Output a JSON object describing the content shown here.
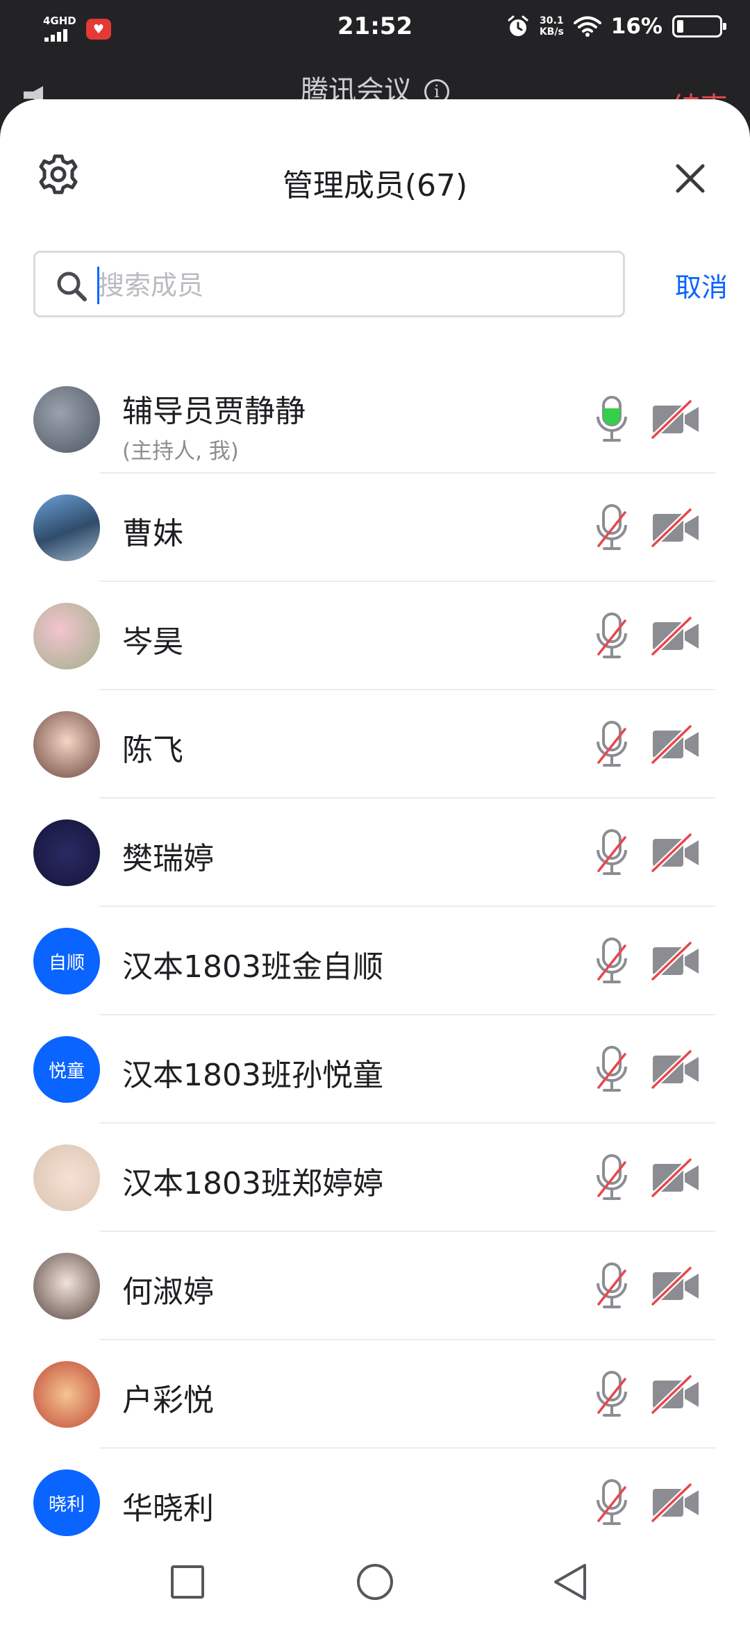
{
  "status_bar": {
    "network": "4GHD",
    "time": "21:52",
    "speed_value": "30.1",
    "speed_unit": "KB/s",
    "battery_percent": "16%",
    "battery_level": 0.16
  },
  "meeting": {
    "title": "腾讯会议",
    "end_label": "结束"
  },
  "sheet": {
    "title": "管理成员(67)",
    "search_placeholder": "搜索成员",
    "cancel_label": "取消"
  },
  "members": [
    {
      "name": "辅导员贾静静",
      "subtitle": "(主持人, 我)",
      "avatar": "photo",
      "avatar_text": "",
      "mic_on": true,
      "camera_on": false
    },
    {
      "name": "曹妹",
      "subtitle": "",
      "avatar": "photo",
      "avatar_text": "",
      "mic_on": false,
      "camera_on": false
    },
    {
      "name": "岑昊",
      "subtitle": "",
      "avatar": "photo",
      "avatar_text": "",
      "mic_on": false,
      "camera_on": false
    },
    {
      "name": "陈飞",
      "subtitle": "",
      "avatar": "photo",
      "avatar_text": "",
      "mic_on": false,
      "camera_on": false
    },
    {
      "name": "樊瑞婷",
      "subtitle": "",
      "avatar": "photo",
      "avatar_text": "",
      "mic_on": false,
      "camera_on": false
    },
    {
      "name": "汉本1803班金自顺",
      "subtitle": "",
      "avatar": "text",
      "avatar_text": "自顺",
      "mic_on": false,
      "camera_on": false
    },
    {
      "name": "汉本1803班孙悦童",
      "subtitle": "",
      "avatar": "text",
      "avatar_text": "悦童",
      "mic_on": false,
      "camera_on": false
    },
    {
      "name": "汉本1803班郑婷婷",
      "subtitle": "",
      "avatar": "photo",
      "avatar_text": "",
      "mic_on": false,
      "camera_on": false
    },
    {
      "name": "何淑婷",
      "subtitle": "",
      "avatar": "photo",
      "avatar_text": "",
      "mic_on": false,
      "camera_on": false
    },
    {
      "name": "户彩悦",
      "subtitle": "",
      "avatar": "photo",
      "avatar_text": "",
      "mic_on": false,
      "camera_on": false
    },
    {
      "name": "华晓利",
      "subtitle": "",
      "avatar": "text",
      "avatar_text": "晓利",
      "mic_on": false,
      "camera_on": false
    }
  ],
  "colors": {
    "accent": "#0a64ff",
    "mic_active": "#35d04a",
    "muted_slash": "#e5484d",
    "icon_gray": "#8b8d92"
  },
  "icons": {
    "settings": "gear-icon",
    "close": "close-icon",
    "search": "search-icon",
    "mic": "microphone-icon",
    "camera": "camera-icon"
  }
}
